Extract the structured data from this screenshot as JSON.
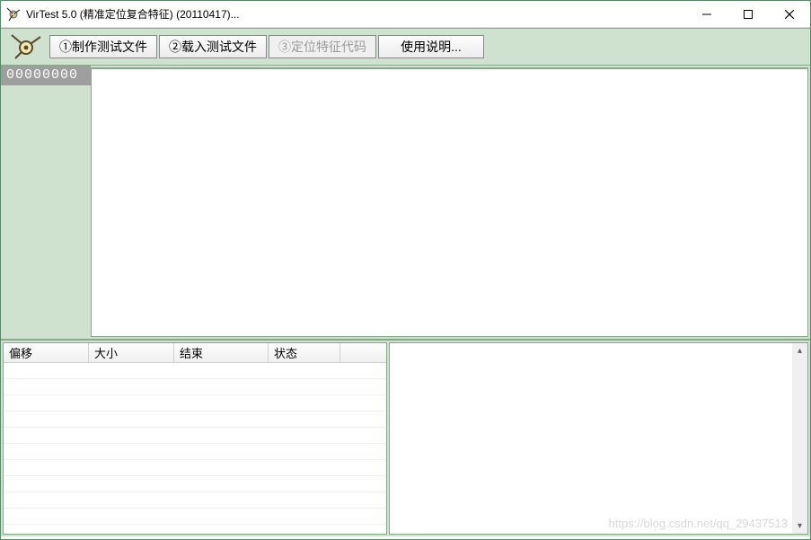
{
  "window": {
    "title": "VirTest 5.0 (精准定位复合特征) (20110417)..."
  },
  "toolbar": {
    "btn1": "①制作测试文件",
    "btn2": "②载入测试文件",
    "btn3": "③定位特征代码",
    "btn4": "使用说明..."
  },
  "gutter": {
    "address": "00000000"
  },
  "table": {
    "headers": [
      "偏移",
      "大小",
      "结束",
      "状态",
      ""
    ]
  },
  "watermark": "https://blog.csdn.net/qq_29437513"
}
